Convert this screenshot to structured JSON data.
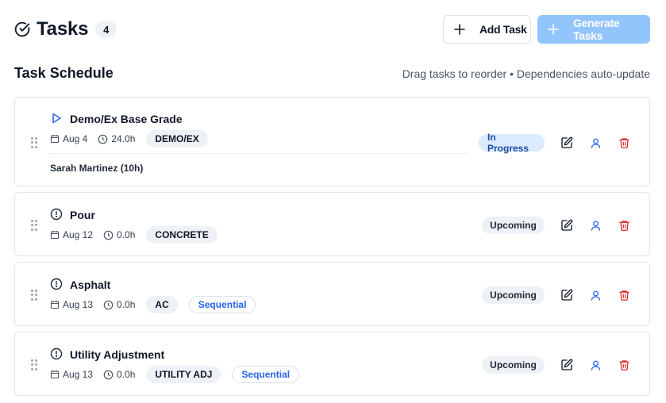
{
  "header": {
    "title": "Tasks",
    "count": "4",
    "add_task_label": "Add Task",
    "generate_tasks_label": "Generate Tasks"
  },
  "schedule": {
    "title": "Task Schedule",
    "hint": "Drag tasks to reorder • Dependencies auto-update"
  },
  "tasks": [
    {
      "name": "Demo/Ex Base Grade",
      "status_icon": "play-icon",
      "date": "Aug 4",
      "hours": "24.0h",
      "tag": "DEMO/EX",
      "assignee": "Sarah Martinez (10h)",
      "status": "In Progress"
    },
    {
      "name": "Pour",
      "status_icon": "alert-circle-icon",
      "date": "Aug 12",
      "hours": "0.0h",
      "tag": "CONCRETE",
      "status": "Upcoming"
    },
    {
      "name": "Asphalt",
      "status_icon": "alert-circle-icon",
      "date": "Aug 13",
      "hours": "0.0h",
      "tag": "AC",
      "dependency": "Sequential",
      "status": "Upcoming"
    },
    {
      "name": "Utility Adjustment",
      "status_icon": "alert-circle-icon",
      "date": "Aug 13",
      "hours": "0.0h",
      "tag": "UTILITY ADJ",
      "dependency": "Sequential",
      "status": "Upcoming"
    }
  ],
  "colors": {
    "accent": "#2563eb",
    "generate_disabled": "#93c5fd",
    "delete": "#dc2626",
    "in_progress_bg": "#dbeafe",
    "upcoming_bg": "#eef1f5"
  }
}
